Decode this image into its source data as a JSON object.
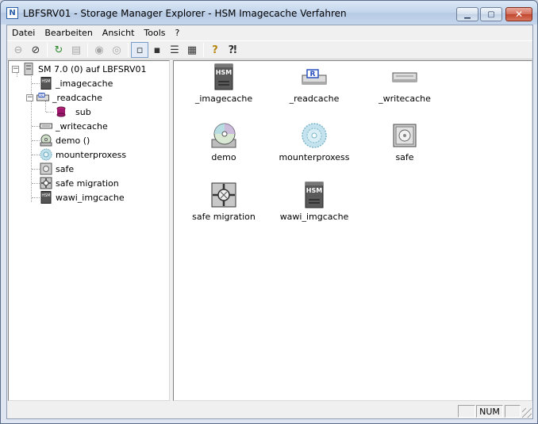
{
  "window": {
    "title": "LBFSRV01 - Storage Manager Explorer  -  HSM Imagecache Verfahren",
    "app_icon_glyph": "N",
    "min_glyph": "▁",
    "max_glyph": "▢",
    "close_glyph": "✕"
  },
  "menu": [
    "Datei",
    "Bearbeiten",
    "Ansicht",
    "Tools",
    "?"
  ],
  "toolbar": [
    {
      "icon": "connect-icon",
      "glyph": "⊖",
      "disabled": true
    },
    {
      "icon": "disconnect-icon",
      "glyph": "⊘",
      "disabled": false
    },
    {
      "icon": "refresh-icon",
      "glyph": "↻",
      "disabled": false
    },
    {
      "icon": "folder-up-icon",
      "glyph": "▤",
      "disabled": true
    },
    {
      "icon": "cd-icon",
      "glyph": "◉",
      "disabled": true
    },
    {
      "icon": "cd-edit-icon",
      "glyph": "◎",
      "disabled": true
    },
    {
      "icon": "large-icons-view-icon",
      "glyph": "▫",
      "active": true
    },
    {
      "icon": "small-icons-view-icon",
      "glyph": "▪",
      "disabled": false
    },
    {
      "icon": "list-view-icon",
      "glyph": "☰",
      "disabled": false
    },
    {
      "icon": "details-view-icon",
      "glyph": "▦",
      "disabled": false
    },
    {
      "icon": "help-icon",
      "glyph": "?",
      "disabled": false
    },
    {
      "icon": "context-help-icon",
      "glyph": "⁈",
      "disabled": false
    }
  ],
  "tree": {
    "root": {
      "label": "SM 7.0 (0) auf LBFSRV01",
      "expander": "−"
    },
    "items": [
      {
        "label": "_imagecache",
        "icon": "hsm-server-icon"
      },
      {
        "label": "_readcache",
        "icon": "readcache-drive-icon",
        "expander": "−"
      },
      {
        "label": "sub",
        "icon": "database-icon"
      },
      {
        "label": "_writecache",
        "icon": "writecache-drive-icon"
      },
      {
        "label": "demo ()",
        "icon": "cd-drive-icon"
      },
      {
        "label": "mounterproxess",
        "icon": "mounter-icon"
      },
      {
        "label": "safe",
        "icon": "safe-icon"
      },
      {
        "label": "safe migration",
        "icon": "migration-icon"
      },
      {
        "label": "wawi_imgcache",
        "icon": "hsm-server-icon"
      }
    ]
  },
  "list": [
    {
      "label": "_imagecache",
      "icon": "hsm-server-icon"
    },
    {
      "label": "_readcache",
      "icon": "readcache-drive-icon"
    },
    {
      "label": "_writecache",
      "icon": "writecache-drive-icon"
    },
    {
      "label": "demo",
      "icon": "cd-drive-icon"
    },
    {
      "label": "mounterproxess",
      "icon": "mounter-icon"
    },
    {
      "label": "safe",
      "icon": "safe-icon"
    },
    {
      "label": "safe migration",
      "icon": "migration-icon"
    },
    {
      "label": "wawi_imgcache",
      "icon": "hsm-server-icon"
    }
  ],
  "statusbar": {
    "num": "NUM"
  },
  "colors": {
    "hsm": "#4a4a4a",
    "drive_blue": "#2a52be",
    "db_purple": "#a0186e"
  }
}
